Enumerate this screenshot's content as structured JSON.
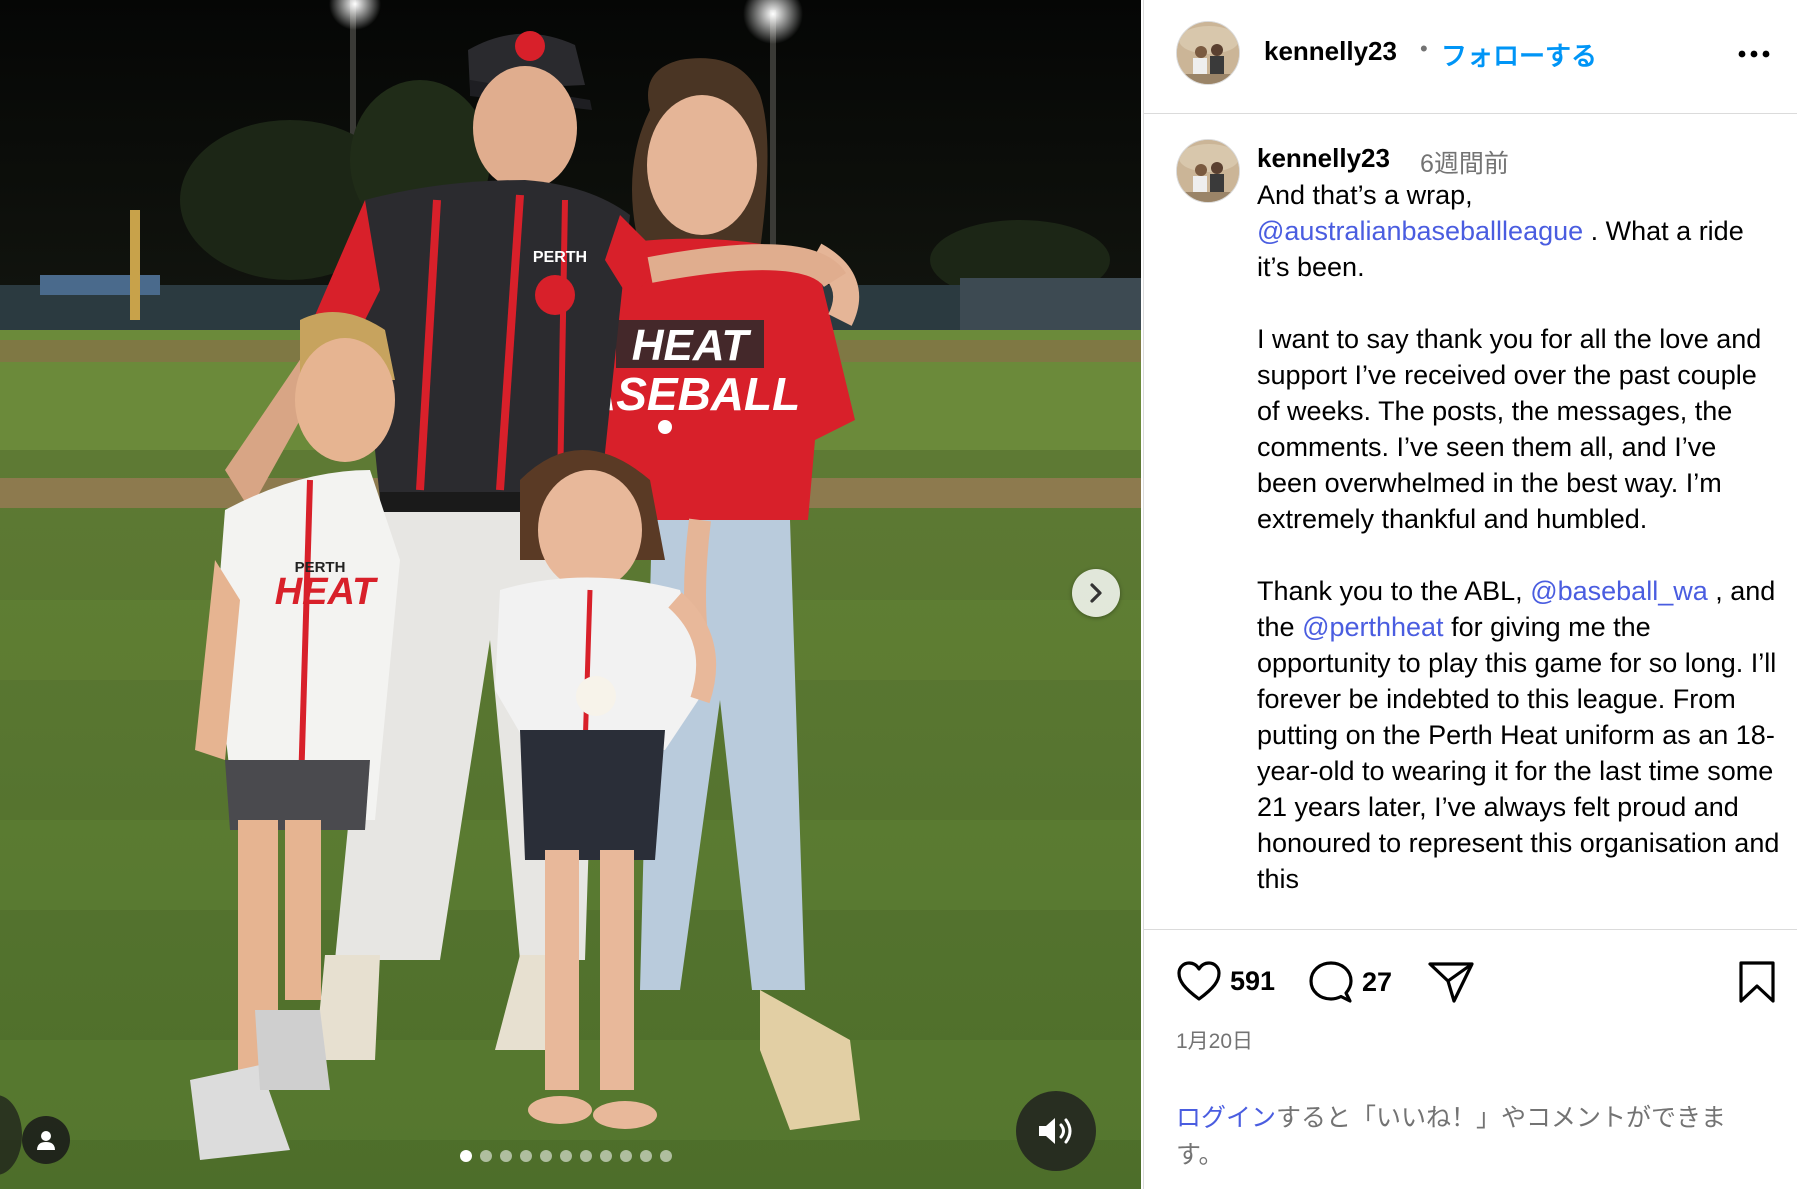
{
  "post": {
    "username": "kennelly23",
    "follow_label": "フォローする",
    "time_ago": "6週間前",
    "date": "1月20日",
    "likes": "591",
    "comments_count": "27"
  },
  "caption": {
    "line1": "And that’s a wrap,",
    "mention_abl": "@australianbaseballleague",
    "after_abl": ". What a ride it’s been.",
    "para2": "I want to say thank you for all the love and support I’ve received over the past couple of weeks. The posts, the messages, the comments. I’ve seen them all, and I’ve been overwhelmed in the best way. I’m extremely thankful and humbled.",
    "para3_start": "Thank you to the ABL,",
    "mention_wa": "@baseball_wa",
    "para3_mid": ", and the",
    "mention_heat": "@perthheat",
    "para3_end": "for giving me the opportunity to play this game for so long. I’ll forever be indebted to this league. From putting on the Perth Heat uniform as an 18-year-old to wearing it for the last time some 21 years later, I’ve always felt proud and honoured to represent this organisation and this"
  },
  "login_prompt": {
    "link": "ログイン",
    "rest": "すると「いいね！」やコメントができます。"
  },
  "photo_text": {
    "shirt_heat": "HEAT",
    "shirt_baseball": "BASEBALL",
    "perth": "PERTH"
  },
  "carousel": {
    "total": 11,
    "active_index": 0
  },
  "icons": {
    "more": "more-dots-icon",
    "like": "heart-icon",
    "comment": "comment-bubble-icon",
    "share": "share-paper-plane-icon",
    "save": "bookmark-icon",
    "next": "chevron-right-icon",
    "sound": "speaker-icon",
    "tag": "user-tag-icon"
  },
  "colors": {
    "link_blue": "#4a5de0",
    "follow_blue": "#0095f6",
    "muted": "#737373",
    "jersey_red": "#d8202a"
  }
}
